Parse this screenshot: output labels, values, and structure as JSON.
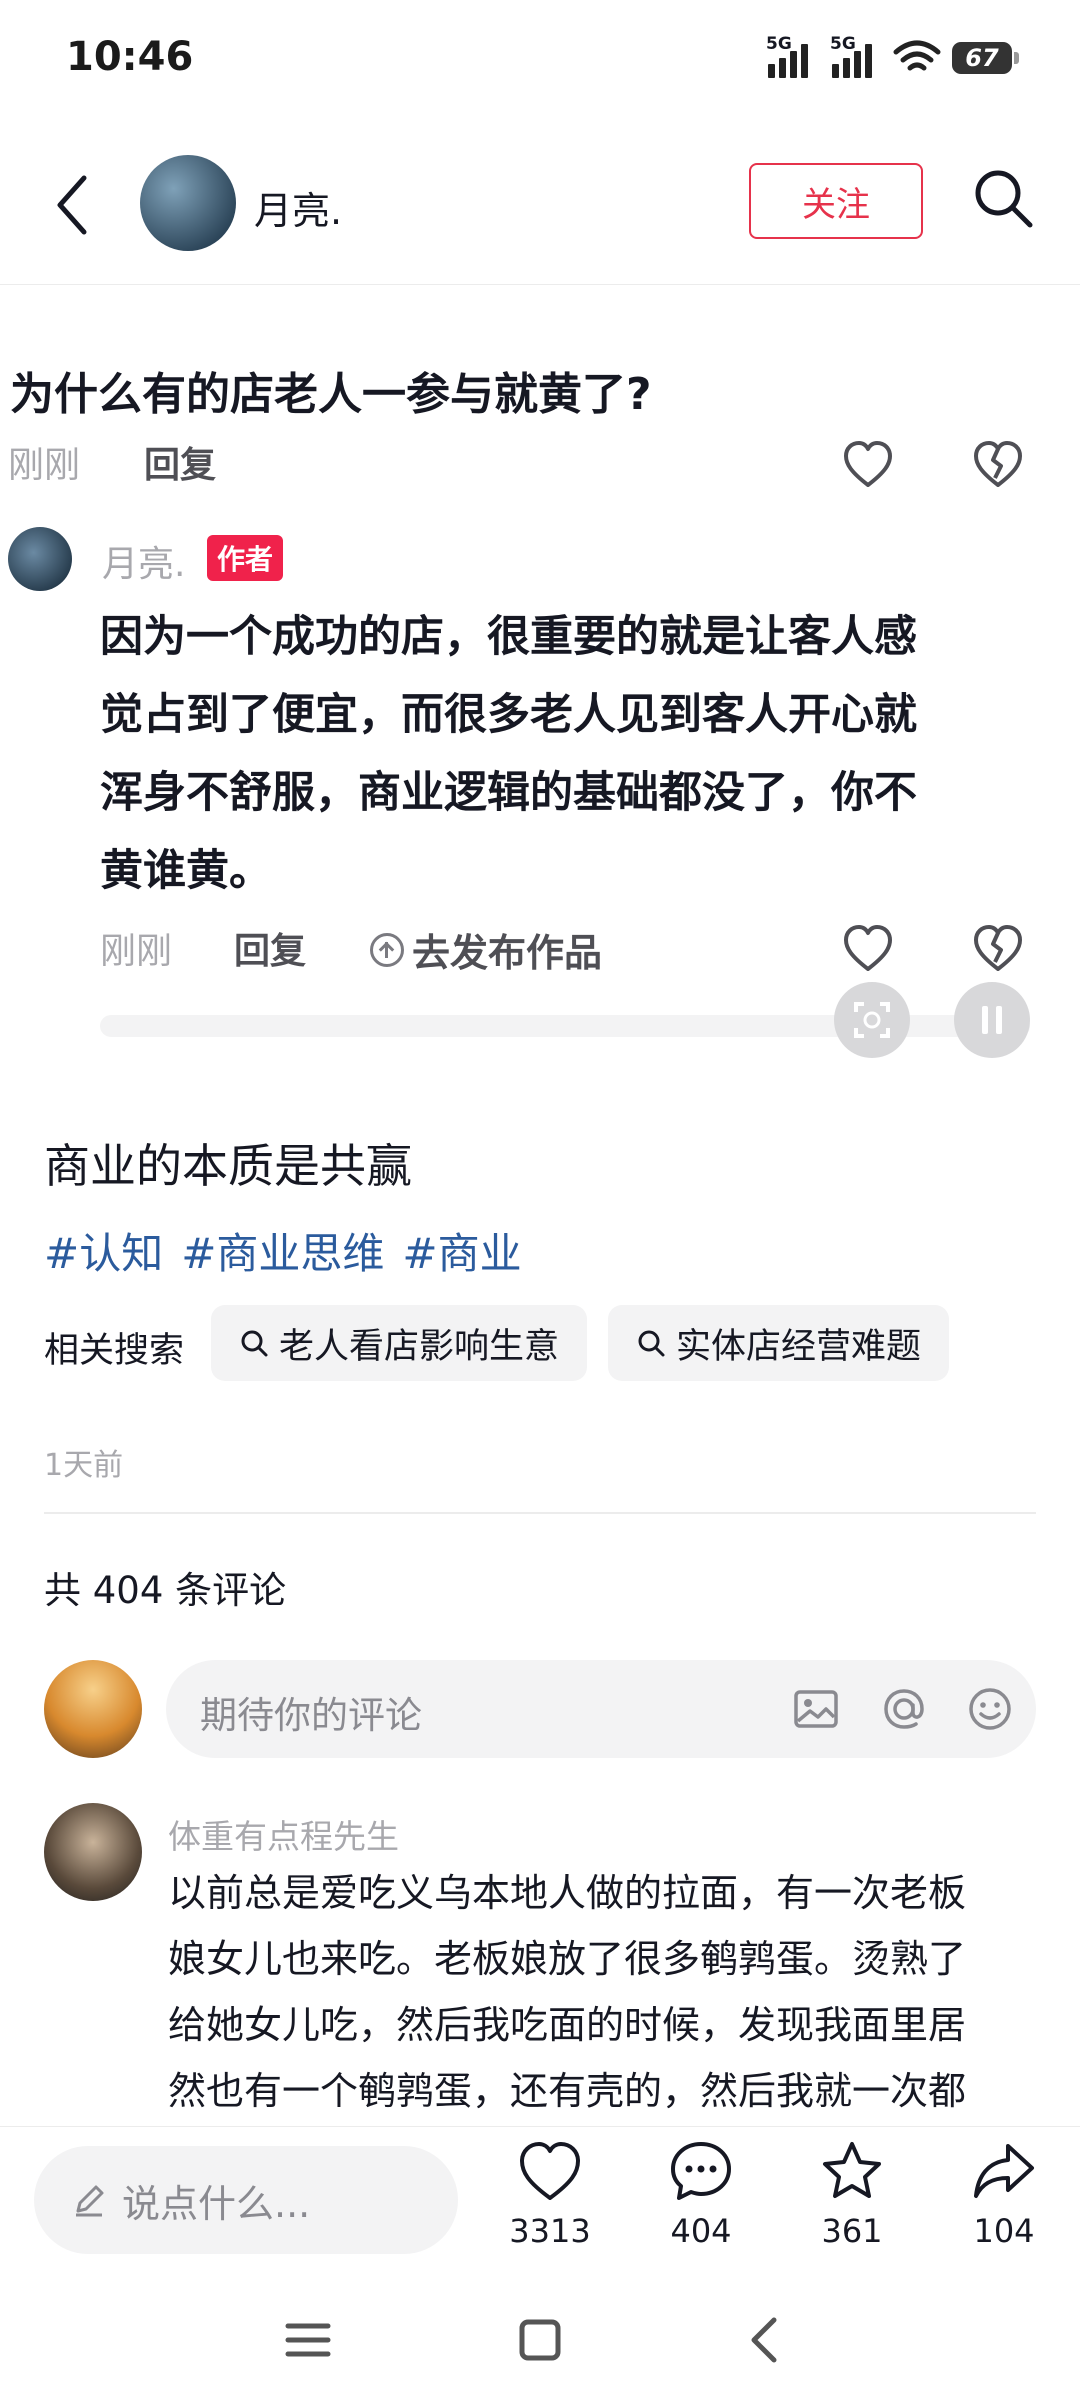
{
  "status_bar": {
    "time": "10:46",
    "network1": "5G",
    "network2": "5G",
    "battery": "67"
  },
  "header": {
    "author": "月亮.",
    "follow_label": "关注"
  },
  "pinned_comment": {
    "question": "为什么有的店老人一参与就黄了?",
    "time": "刚刚",
    "reply_label": "回复",
    "reply": {
      "author": "月亮.",
      "badge": "作者",
      "lines": [
        "因为一个成功的店，很重要的就是让客人感",
        "觉占到了便宜，而很多老人见到客人开心就",
        "浑身不舒服，商业逻辑的基础都没了，你不",
        "黄谁黄。"
      ],
      "time": "刚刚",
      "reply_label": "回复",
      "publish_label": "去发布作品"
    }
  },
  "post": {
    "title": "商业的本质是共赢",
    "hashtags": [
      "#认知",
      "#商业思维",
      "#商业"
    ],
    "related_label": "相关搜索",
    "related": [
      "老人看店影响生意",
      "实体店经营难题"
    ],
    "timestamp": "1天前",
    "comment_count_text": "共 404 条评论"
  },
  "comment_input": {
    "placeholder": "期待你的评论"
  },
  "comments": [
    {
      "author": "体重有点程先生",
      "lines": [
        "以前总是爱吃义乌本地人做的拉面，有一次老板",
        "娘女儿也来吃。老板娘放了很多鹌鹑蛋。烫熟了",
        "给她女儿吃，然后我吃面的时候，发现我面里居",
        "然也有一个鹌鹑蛋，还有壳的，然后我就一次都"
      ]
    }
  ],
  "bottom_bar": {
    "say_placeholder": "说点什么...",
    "likes": "3313",
    "comments": "404",
    "favorites": "361",
    "shares": "104"
  },
  "colors": {
    "accent_red": "#e6324b",
    "hashtag_blue": "#2b5b9d",
    "badge_red": "#f0224b"
  }
}
